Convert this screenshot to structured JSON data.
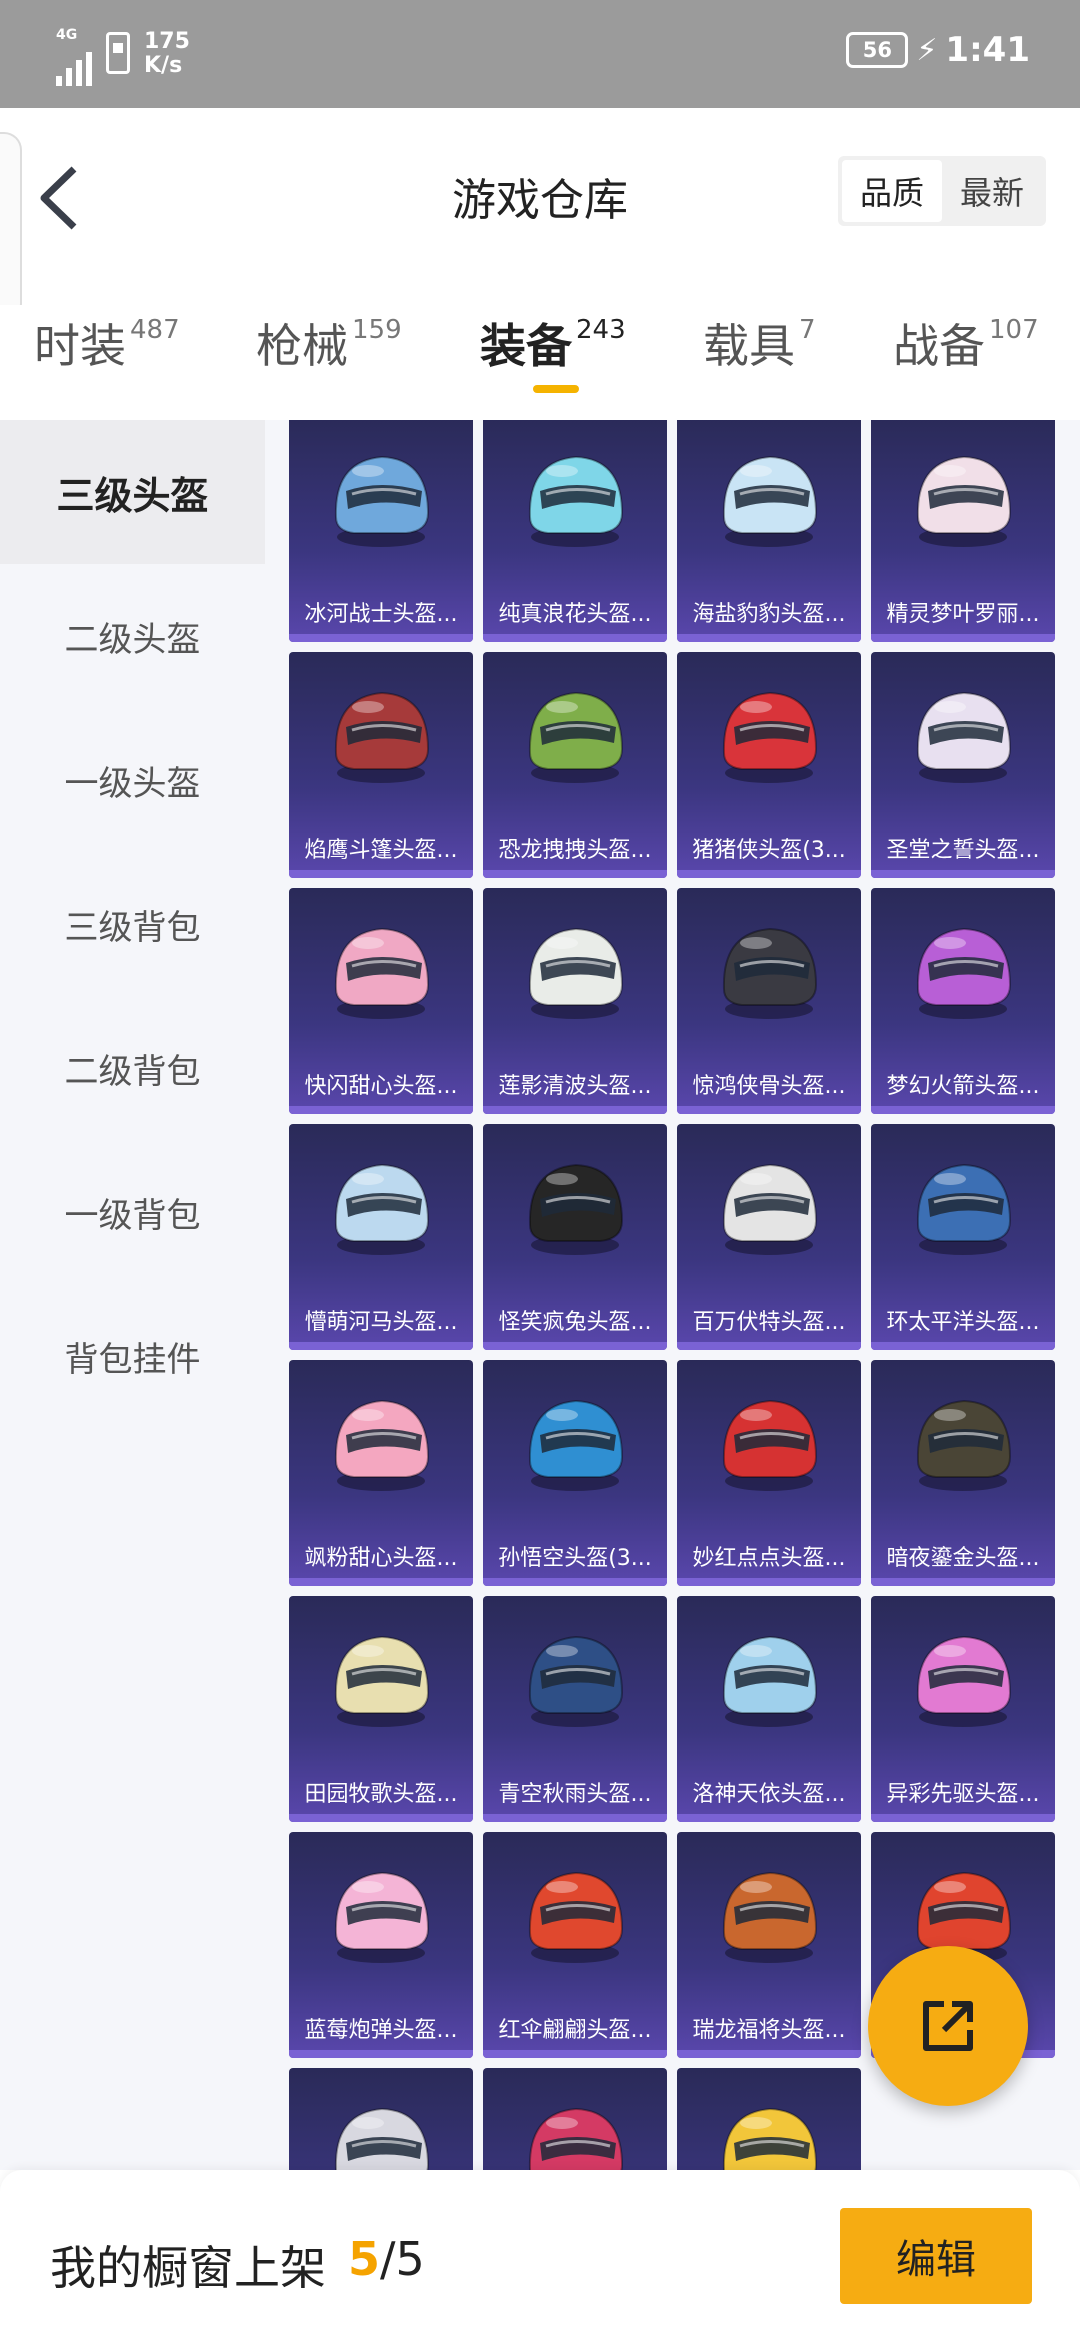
{
  "status_bar": {
    "network": "4G",
    "speed_value": "175",
    "speed_unit": "K/s",
    "battery": "56",
    "time": "1:41"
  },
  "header": {
    "title": "游戏仓库",
    "sort_options": [
      "品质",
      "最新"
    ],
    "sort_selected": "品质"
  },
  "tabs": [
    {
      "label": "时装",
      "count": "487"
    },
    {
      "label": "枪械",
      "count": "159"
    },
    {
      "label": "装备",
      "count": "243"
    },
    {
      "label": "载具",
      "count": "7"
    },
    {
      "label": "战备",
      "count": "107"
    }
  ],
  "active_tab": "装备",
  "sidebar": {
    "items": [
      "三级头盔",
      "二级头盔",
      "一级头盔",
      "三级背包",
      "二级背包",
      "一级背包",
      "背包挂件"
    ],
    "active": "三级头盔"
  },
  "items": [
    {
      "name": "冰河战士头盔...",
      "color": "#6fa8dc"
    },
    {
      "name": "纯真浪花头盔...",
      "color": "#7fd6e8"
    },
    {
      "name": "海盐豹豹头盔...",
      "color": "#c9e4f5"
    },
    {
      "name": "精灵梦叶罗丽...",
      "color": "#f1dfe8"
    },
    {
      "name": "焰鹰斗篷头盔...",
      "color": "#a63a3a"
    },
    {
      "name": "恐龙拽拽头盔...",
      "color": "#7fae4a"
    },
    {
      "name": "猪猪侠头盔(3...",
      "color": "#d9343a"
    },
    {
      "name": "圣堂之誓头盔...",
      "color": "#e8e0f0"
    },
    {
      "name": "快闪甜心头盔...",
      "color": "#f0a8c4"
    },
    {
      "name": "莲影清波头盔...",
      "color": "#e9ece8"
    },
    {
      "name": "惊鸿侠骨头盔...",
      "color": "#3a3a42"
    },
    {
      "name": "梦幻火箭头盔...",
      "color": "#b85fd6"
    },
    {
      "name": "懵萌河马头盔...",
      "color": "#bcd9ef"
    },
    {
      "name": "怪笑疯兔头盔...",
      "color": "#262626"
    },
    {
      "name": "百万伏特头盔...",
      "color": "#e4e4e4"
    },
    {
      "name": "环太平洋头盔...",
      "color": "#3c6fb4"
    },
    {
      "name": "飒粉甜心头盔...",
      "color": "#f4a7c0"
    },
    {
      "name": "孙悟空头盔(3...",
      "color": "#2f8fd2"
    },
    {
      "name": "妙红点点头盔...",
      "color": "#d63232"
    },
    {
      "name": "暗夜鎏金头盔...",
      "color": "#4a4536"
    },
    {
      "name": "田园牧歌头盔...",
      "color": "#e8dfb0"
    },
    {
      "name": "青空秋雨头盔...",
      "color": "#2e4f86"
    },
    {
      "name": "洛神天依头盔...",
      "color": "#9fd0ec"
    },
    {
      "name": "异彩先驱头盔...",
      "color": "#e27ad2"
    },
    {
      "name": "蓝莓炮弹头盔...",
      "color": "#f4b4d6"
    },
    {
      "name": "红伞翩翩头盔...",
      "color": "#e0482e"
    },
    {
      "name": "瑞龙福将头盔...",
      "color": "#c9672e"
    },
    {
      "name": "",
      "color": "#e0442e"
    },
    {
      "name": "",
      "color": "#d8d8e0"
    },
    {
      "name": "",
      "color": "#d43a64"
    },
    {
      "name": "",
      "color": "#f2c63a"
    }
  ],
  "fab": {
    "icon": "share-external-icon"
  },
  "bottom_bar": {
    "label": "我的橱窗上架",
    "used": "5",
    "separator": "/",
    "total": "5",
    "edit_label": "编辑"
  },
  "colors": {
    "accent": "#f6ac12",
    "card_bg_top": "#2a2a58",
    "card_bg_bottom": "#5a47ad"
  }
}
